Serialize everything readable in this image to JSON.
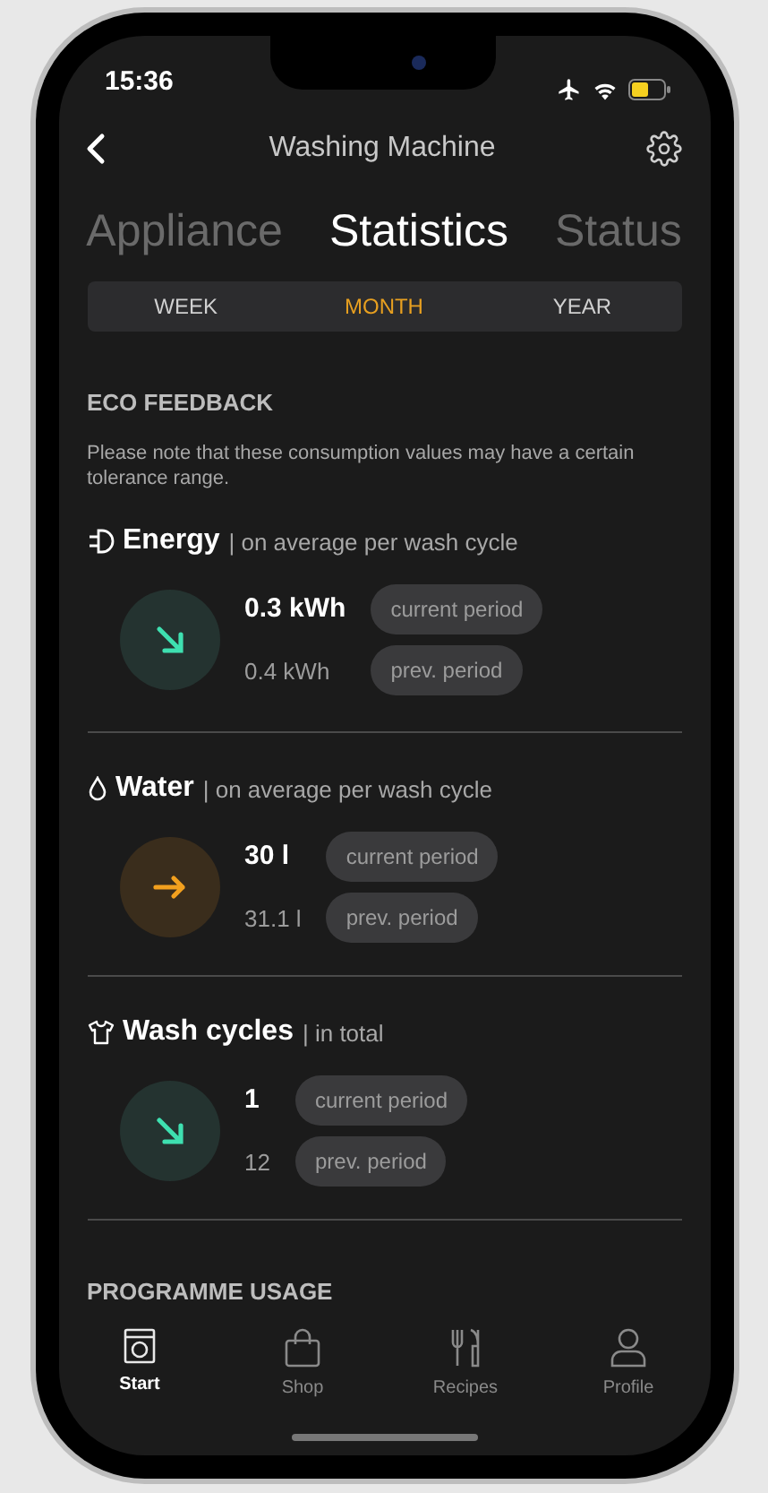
{
  "status_bar": {
    "time": "15:36"
  },
  "nav": {
    "title": "Washing Machine"
  },
  "tabs": [
    {
      "label": "Appliance",
      "selected": false
    },
    {
      "label": "Statistics",
      "selected": true
    },
    {
      "label": "Status",
      "selected": false
    }
  ],
  "periods": [
    {
      "label": "WEEK",
      "selected": false
    },
    {
      "label": "MONTH",
      "selected": true
    },
    {
      "label": "YEAR",
      "selected": false
    }
  ],
  "eco_feedback": {
    "heading": "ECO FEEDBACK",
    "note": "Please note that these consumption values may have a certain tolerance range.",
    "metrics": [
      {
        "kind": "energy",
        "name": "Energy",
        "qualifier": "| on average per wash cycle",
        "indicator": {
          "kind": "down"
        },
        "current_value": "0.3 kWh",
        "current_label": "current period",
        "previous_value": "0.4 kWh",
        "previous_label": "prev. period"
      },
      {
        "kind": "water",
        "name": "Water",
        "qualifier": "| on average per wash cycle",
        "indicator": {
          "kind": "flat"
        },
        "current_value": "30 l",
        "current_label": "current period",
        "previous_value": "31.1 l",
        "previous_label": "prev. period"
      },
      {
        "kind": "cycles",
        "name": "Wash cycles",
        "qualifier": "| in total",
        "indicator": {
          "kind": "down"
        },
        "current_value": "1",
        "current_label": "current period",
        "previous_value": "12",
        "previous_label": "prev. period"
      }
    ]
  },
  "programme_usage": {
    "heading": "PROGRAMME USAGE"
  },
  "tab_bar": [
    {
      "kind": "start",
      "label": "Start",
      "selected": true
    },
    {
      "kind": "shop",
      "label": "Shop",
      "selected": false
    },
    {
      "kind": "recipes",
      "label": "Recipes",
      "selected": false
    },
    {
      "kind": "profile",
      "label": "Profile",
      "selected": false
    }
  ]
}
